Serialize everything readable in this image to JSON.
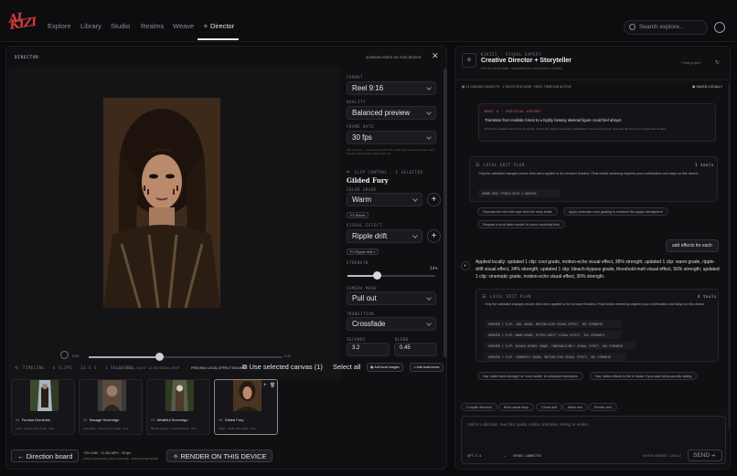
{
  "nav": {
    "logo": "AI\nKIZI",
    "items": [
      "Explore",
      "Library",
      "Studio",
      "Realms",
      "Weave",
      "Director"
    ],
    "search_placeholder": "Search explore..."
  },
  "director": {
    "title": "DIRECTOR",
    "media_stays": "MEDIA STAYS ON THIS DEVICE",
    "time_start": "0:00",
    "time_end": "0:11",
    "playback_info": "16 LOCAL CUES · 12 SECONDS CROP",
    "preview_badge": "PREVIEW LOCAL EFFECT ENGINE",
    "format_label": "FORMAT",
    "format_value": "Reel 9:16",
    "quality_label": "QUALITY",
    "quality_value": "Balanced preview",
    "framerate_label": "FRAME RATE",
    "framerate_value": "30 fps",
    "hint": "Clip controls — visual effects will soften. Edit. Use one-time timeline and images hide until the source API yes.",
    "clip_control_label": "CLIP CONTROL · 1 SELECTED",
    "clip_name": "Gilded Fury",
    "color_grade_label": "COLOR GRADE",
    "color_grade_value": "Warm",
    "color_chip": "FX Warm",
    "visual_effect_label": "VISUAL EFFECT",
    "visual_effect_value": "Ripple drift",
    "visual_chip": "FX Ripple drift",
    "strength_label": "STRENGTH",
    "strength_value": "34%",
    "strength_fraction": 0.34,
    "camera_label": "CAMERA MOVE",
    "camera_value": "Pull out",
    "transition_label": "TRANSITION",
    "transition_value": "Crossfade",
    "seconds_label": "SECONDS",
    "seconds_value": "3.2",
    "blend_label": "BLEND",
    "blend_value": "0.45",
    "timeline_label": "TIMELINE · 4 CLIPS · 13.5 S · 1 SELECTED",
    "use_canvas": "Use selected canvas (1)",
    "select_all": "Select all",
    "add_images": "Add local images",
    "add_music": "Add local music",
    "clips": [
      {
        "num": "01",
        "name": "Furious Dominion",
        "sub": "Cool · motion-echo visual · 3.5s"
      },
      {
        "num": "02",
        "name": "Savage Sovereign",
        "sub": "Cinematic · motion-echo visual · 3.5s"
      },
      {
        "num": "03",
        "name": "Wrathful Sovereign",
        "sub": "Bleach-bypass · threshold-melt · 3.5s"
      },
      {
        "num": "04",
        "name": "Gilded Fury",
        "sub": "Warm · ripple-drift visual · 3.0s"
      }
    ],
    "direction_board": "Direction board",
    "render_meta_1": "720×1280 · 11.264 MPX · 30 fps",
    "render_meta_2": "SINGLE MACHINE LOCAL ENCODE · 3000 RASTER MODE",
    "render_button": "RENDER ON THIS DEVICE"
  },
  "chat": {
    "eyebrow": "KIKIZI · VISUAL EXPERT",
    "title": "Creative Director + Storyteller",
    "subtitle": "Give the canvas stats · streamlines the Lotus Director Contract",
    "new_project": "New project",
    "canvas_objects": "11 CANVAS OBJECTS · 1 SELECTED NOW · REEL TIMELINE ACTIVE",
    "saved_locally": "SAVED LOCALLY",
    "beat_label": "BEAT 4 · SKELETAL ASCENT",
    "beat_text": "Transition from realistic forest to a highly fantasy skeletal figure could feel abrupt.",
    "beat_detail": "Ensure the skeletal warrior's bone texture mirrors the earthy tree aurally established in the second grove, and ease the skin to bone light fade shadow.",
    "plan1_title": "LOCAL EDIT PLAN",
    "plan1_tools": "1 tools",
    "plan1_text": "Only the validated changes shown here were applied to the browser timeline. Final media rendering requires your confirmation and stays on this device.",
    "plan1_line": "ADDED REEL STUDIO WITH 4 SOURCES",
    "suggest1": "Populate the reel with clips from the story beats",
    "suggest2": "Apply cinematic color grading to enhance the pagan atmosphere",
    "suggest3": "Request a local video render to check continuity flow",
    "user_msg": "add effects for each",
    "reply": "Applied locally: updated 1 clip: cool grade, motion-echo visual effect, 38% strength; updated 1 clip: warm grade, ripple-drift visual effect, 34% strength; updated 1 clip: bleach-bypass grade, threshold-melt visual effect, 56% strength; updated 1 clip: cinematic grade, motion-echo visual effect, 30% strength.",
    "plan2_title": "LOCAL EDIT PLAN",
    "plan2_tools": "4 tools",
    "plan2_text": "Only the validated changes shown here were applied to the browser timeline. Final media rendering requires your confirmation and stays on this device.",
    "plan2_lines": [
      "UPDATED 1 CLIP: COOL GRADE, MOTION-ECHO VISUAL EFFECT, 38% STRENGTH",
      "UPDATED 1 CLIP: WARM GRADE, RIPPLE-DRIFT VISUAL EFFECT, 34% STRENGTH",
      "UPDATED 1 CLIP: BLEACH-BYPASS GRADE, THRESHOLD-MELT VISUAL EFFECT, 56% STRENGTH",
      "UPDATED 1 CLIP: CINEMATIC GRADE, MOTION-ECHO VISUAL EFFECT, 30% STRENGTH"
    ],
    "suggest4": "Say 'make them stronger' or 'more subtle' to rebalance intensities",
    "suggest5": "Say 'match effects to the re-beats' if you want story-specific styling",
    "quick": [
      "Compile direction",
      "Build visual story",
      "Check drift",
      "Make reel",
      "Render reel"
    ],
    "input_placeholder": "Ask for a direction, reel, blur, grade, motion, transition, timing, or render...",
    "model": "GPT-5.4",
    "ollama": "OPENAI CONNECTED",
    "review": "REVIEW RENDERS LOCALLY",
    "send": "SEND"
  }
}
